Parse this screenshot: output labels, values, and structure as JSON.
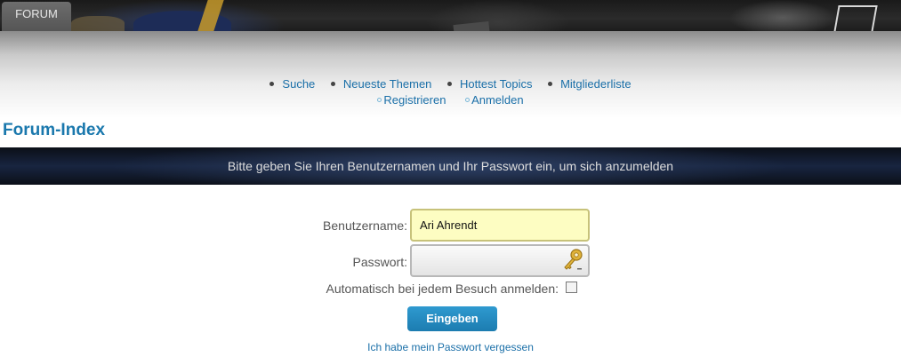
{
  "top_tab": {
    "label": "FORUM"
  },
  "nav": {
    "row1": [
      {
        "label": "Suche"
      },
      {
        "label": "Neueste Themen"
      },
      {
        "label": "Hottest Topics"
      },
      {
        "label": "Mitgliederliste"
      }
    ],
    "row2": [
      {
        "label": "Registrieren"
      },
      {
        "label": "Anmelden"
      }
    ]
  },
  "page": {
    "title": "Forum-Index"
  },
  "message": "Bitte geben Sie Ihren Benutzernamen und Ihr Passwort ein, um sich anzumelden",
  "form": {
    "username_label": "Benutzername:",
    "username_value": "Ari Ahrendt",
    "password_label": "Passwort:",
    "password_value": "",
    "auto_login_label": "Automatisch bei jedem Besuch anmelden:",
    "auto_login_checked": false,
    "submit_label": "Eingeben",
    "forgot_link": "Ich habe mein Passwort vergessen"
  },
  "icons": {
    "password_field": "key-icon",
    "nav_bullet": "bullet-icon"
  },
  "colors": {
    "link": "#1a6fa8",
    "title": "#1a78ad",
    "button": "#1c7cb0",
    "username_field_bg": "#fdfdc2"
  }
}
